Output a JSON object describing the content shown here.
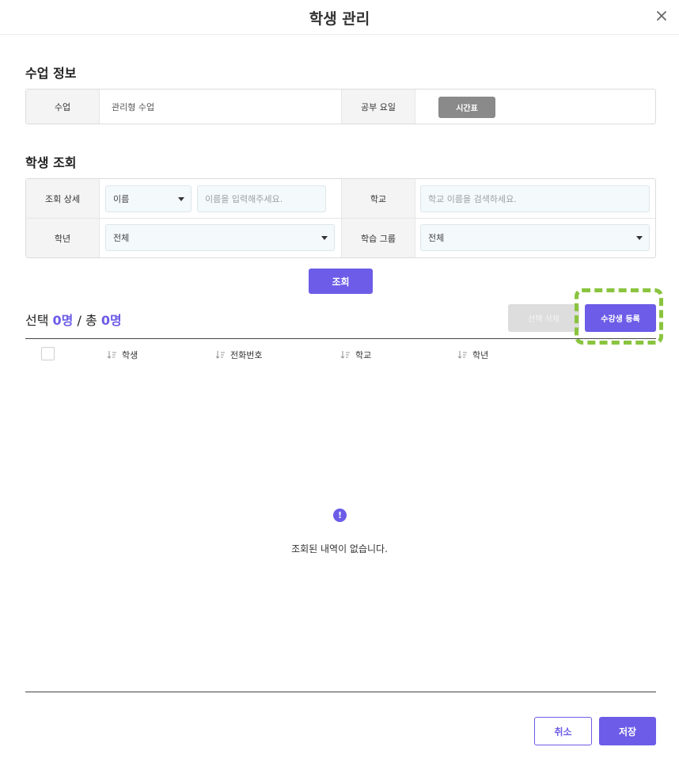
{
  "modal": {
    "title": "학생 관리",
    "close_icon": "close-icon"
  },
  "class_info": {
    "section_title": "수업 정보",
    "class_label": "수업",
    "class_value": "관리형 수업",
    "study_day_label": "공부 요일",
    "timetable_button": "시간표"
  },
  "student_search": {
    "section_title": "학생 조회",
    "detail_label": "조회 상세",
    "detail_select_value": "이름",
    "name_input_placeholder": "이름을 입력해주세요.",
    "school_label": "학교",
    "school_input_placeholder": "학교 이름을 검색하세요.",
    "grade_label": "학년",
    "grade_select_value": "전체",
    "group_label": "학습 그룹",
    "group_select_value": "전체",
    "search_button": "조회"
  },
  "selection": {
    "prefix": "선택",
    "selected_count": "0명",
    "separator": "/",
    "total_prefix": "총",
    "total_count": "0명",
    "delete_button": "선택 삭제",
    "register_button": "수강생 등록"
  },
  "table": {
    "columns": [
      "학생",
      "전화번호",
      "학교",
      "학년"
    ],
    "empty_icon": "!",
    "empty_message": "조회된 내역이 없습니다."
  },
  "footer": {
    "cancel_button": "취소",
    "save_button": "저장"
  },
  "colors": {
    "accent": "#6c5ce7",
    "highlight": "#8ac43f"
  }
}
